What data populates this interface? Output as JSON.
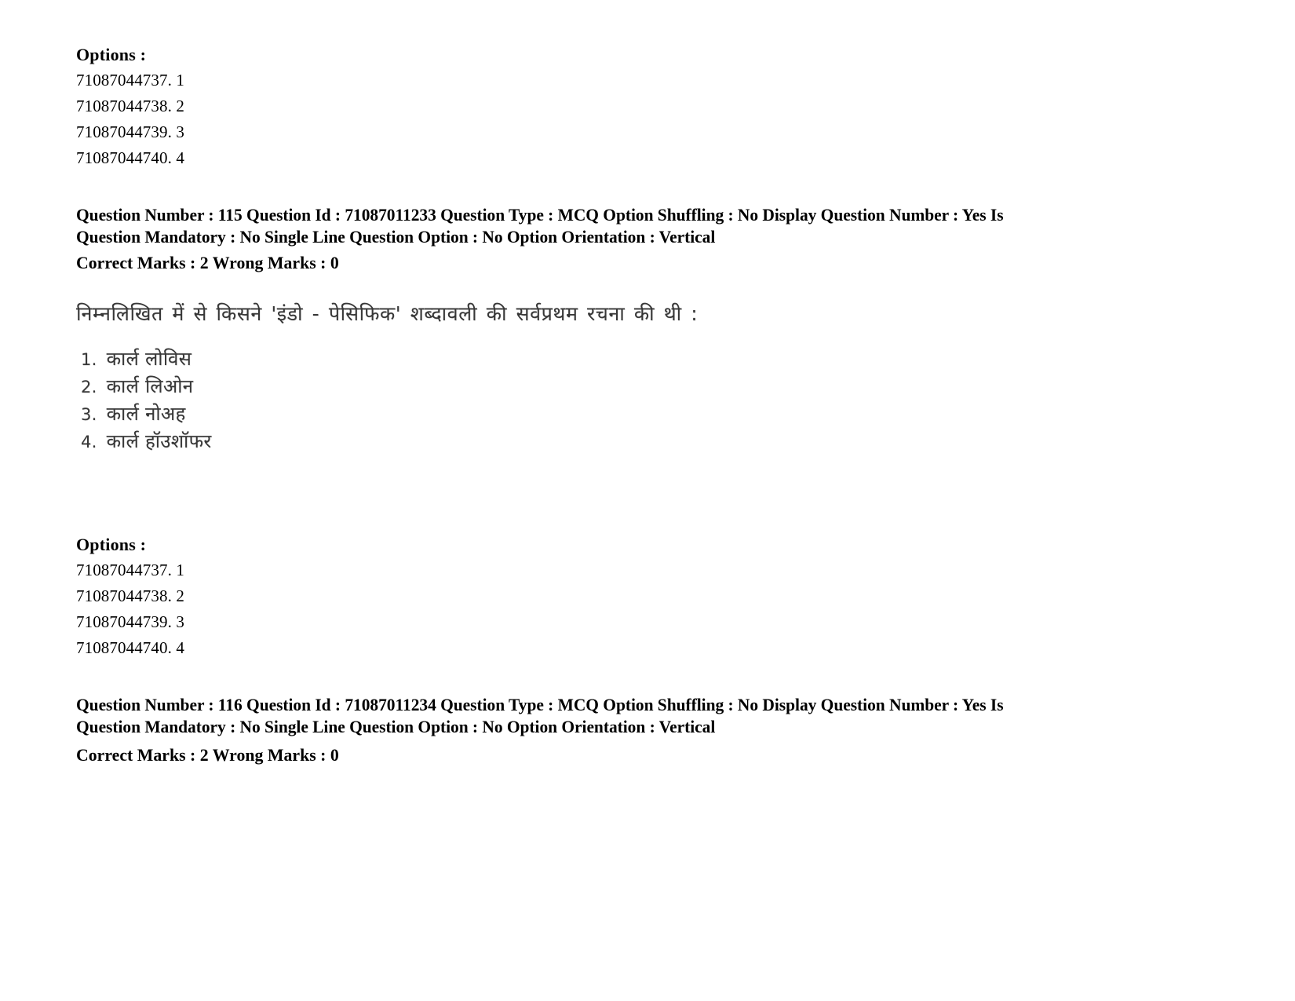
{
  "page": {
    "background_color": "#ffffff",
    "text_color": "#000000"
  },
  "options_block_top": {
    "heading": "Options :",
    "rows": [
      {
        "id": "71087044737.",
        "number": "1"
      },
      {
        "id": "71087044738.",
        "number": "2"
      },
      {
        "id": "71087044739.",
        "number": "3"
      },
      {
        "id": "71087044740.",
        "number": "4"
      }
    ]
  },
  "question_115": {
    "meta_line_1": "Question Number : 115 Question Id : 71087011233 Question Type : MCQ Option Shuffling : No Display Question Number : Yes Is",
    "meta_line_2": "Question Mandatory : No Single Line Question Option : No Option Orientation : Vertical",
    "marks_line": "Correct Marks : 2 Wrong Marks : 0",
    "question_text": "निम्नलिखित में से किसने 'इंडो - पेसिफिक' शब्दावली की सर्वप्रथम रचना की थी :",
    "choices": [
      {
        "num": "1.",
        "text": "कार्ल लोविस"
      },
      {
        "num": "2.",
        "text": "कार्ल लिओन"
      },
      {
        "num": "3.",
        "text": "कार्ल नोअह"
      },
      {
        "num": "4.",
        "text": "कार्ल हॉउशॉफर"
      }
    ]
  },
  "options_block_bottom": {
    "heading": "Options :",
    "rows": [
      {
        "id": "71087044737.",
        "number": "1"
      },
      {
        "id": "71087044738.",
        "number": "2"
      },
      {
        "id": "71087044739.",
        "number": "3"
      },
      {
        "id": "71087044740.",
        "number": "4"
      }
    ]
  },
  "question_116": {
    "meta_line_1": "Question Number : 116 Question Id : 71087011234 Question Type : MCQ Option Shuffling : No Display Question Number : Yes Is",
    "meta_line_2": "Question Mandatory : No Single Line Question Option : No Option Orientation : Vertical",
    "marks_line": "Correct Marks : 2 Wrong Marks : 0"
  }
}
